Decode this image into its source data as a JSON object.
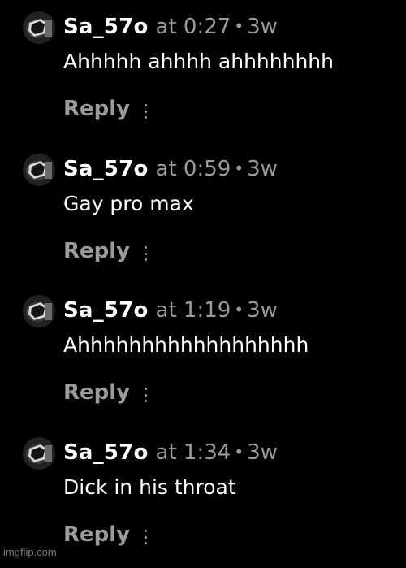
{
  "comments": [
    {
      "username": "Sa_57o",
      "at_prefix": "at",
      "timestamp": "0:27",
      "separator": "•",
      "age": "3w",
      "text": "Ahhhhh ahhhh ahhhhhhhh",
      "reply_label": "Reply",
      "avatar_icon": "avatar-icon",
      "more_icon": "more-options-icon"
    },
    {
      "username": "Sa_57o",
      "at_prefix": "at",
      "timestamp": "0:59",
      "separator": "•",
      "age": "3w",
      "text": "Gay pro max",
      "reply_label": "Reply",
      "avatar_icon": "avatar-icon",
      "more_icon": "more-options-icon"
    },
    {
      "username": "Sa_57o",
      "at_prefix": "at",
      "timestamp": "1:19",
      "separator": "•",
      "age": "3w",
      "text": "Ahhhhhhhhhhhhhhhhhh",
      "reply_label": "Reply",
      "avatar_icon": "avatar-icon",
      "more_icon": "more-options-icon"
    },
    {
      "username": "Sa_57o",
      "at_prefix": "at",
      "timestamp": "1:34",
      "separator": "•",
      "age": "3w",
      "text": "Dick in his throat",
      "reply_label": "Reply",
      "avatar_icon": "avatar-icon",
      "more_icon": "more-options-icon"
    }
  ],
  "watermark": "imgflip.com",
  "colors": {
    "background": "#000000",
    "primary_text": "#ffffff",
    "secondary_text": "#9b9b9b"
  }
}
